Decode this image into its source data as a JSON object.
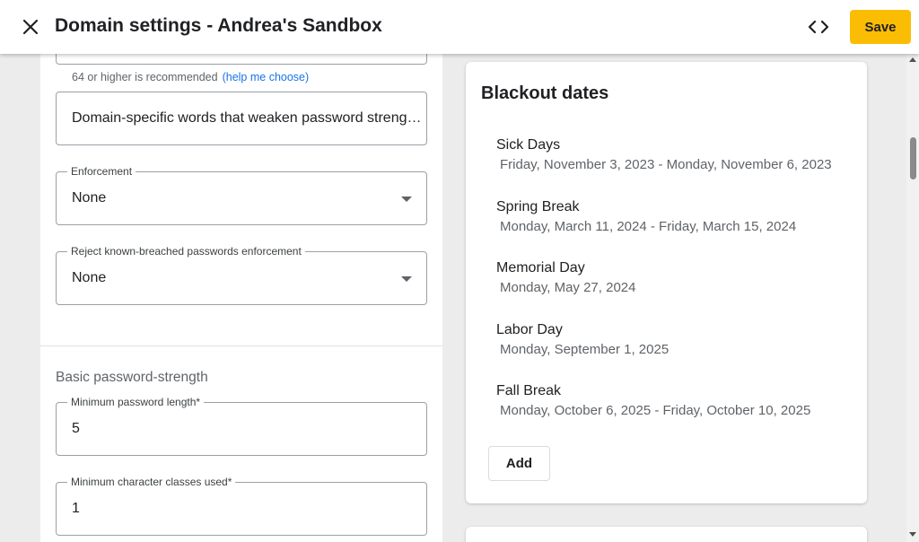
{
  "header": {
    "title": "Domain settings - Andrea's Sandbox",
    "close_icon": "close-icon",
    "code_icon": "code-icon",
    "save_label": "Save"
  },
  "left": {
    "hint_text": "64 or higher is recommended",
    "hint_link": "(help me choose)",
    "domain_words_value": "Domain-specific words that weaken password streng…",
    "enforcement": {
      "label": "Enforcement",
      "value": "None"
    },
    "breached": {
      "label": "Reject known-breached passwords enforcement",
      "value": "None"
    },
    "section_title": "Basic password-strength",
    "min_length": {
      "label": "Minimum password length*",
      "value": "5"
    },
    "min_classes": {
      "label": "Minimum character classes used*",
      "value": "1"
    }
  },
  "blackout": {
    "title": "Blackout dates",
    "items": [
      {
        "name": "Sick Days",
        "range": "Friday, November 3, 2023 - Monday, November 6, 2023"
      },
      {
        "name": "Spring Break",
        "range": "Monday, March 11, 2024 - Friday, March 15, 2024"
      },
      {
        "name": "Memorial Day",
        "range": "Monday, May 27, 2024"
      },
      {
        "name": "Labor Day",
        "range": "Monday, September 1, 2025"
      },
      {
        "name": "Fall Break",
        "range": "Monday, October 6, 2025 - Friday, October 10, 2025"
      }
    ],
    "add_label": "Add"
  },
  "colors": {
    "accent": "#fbbc04",
    "link": "#1a73e8"
  }
}
